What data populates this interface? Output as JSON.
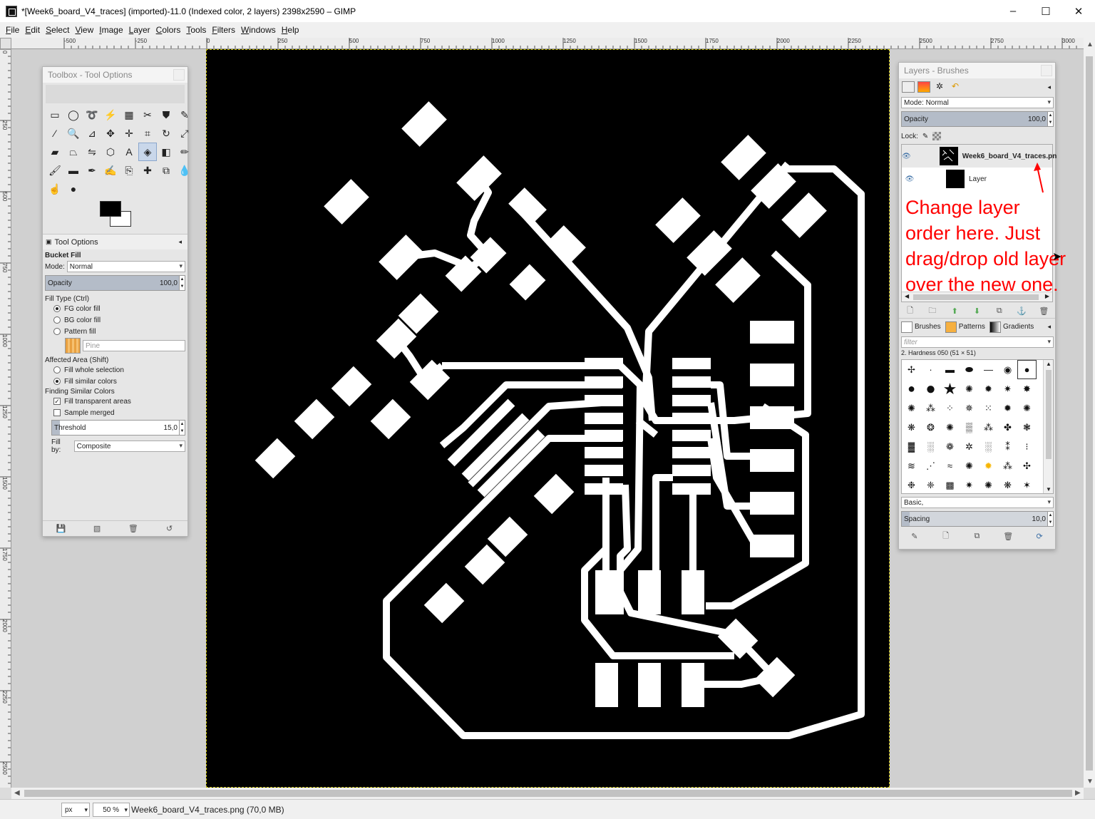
{
  "window": {
    "title": "*[Week6_board_V4_traces] (imported)-11.0 (Indexed color, 2 layers) 2398x2590 – GIMP",
    "minimize": "–",
    "maximize": "☐",
    "close": "✕"
  },
  "menu": [
    "File",
    "Edit",
    "Select",
    "View",
    "Image",
    "Layer",
    "Colors",
    "Tools",
    "Filters",
    "Windows",
    "Help"
  ],
  "ruler": {
    "top_labels": [
      "-500",
      "-250",
      "0",
      "250",
      "500",
      "750",
      "1000",
      "1250",
      "1500",
      "1750",
      "2000",
      "2250",
      "2500",
      "2750",
      "3000"
    ],
    "left_labels": [
      "0",
      "250",
      "500",
      "750",
      "1000",
      "1250",
      "1500",
      "1750",
      "2000",
      "2250",
      "2500"
    ]
  },
  "toolbox": {
    "title": "Toolbox - Tool Options",
    "tool_options_tab": "Tool Options",
    "tool_name": "Bucket Fill",
    "mode_label": "Mode:",
    "mode_value": "Normal",
    "opacity_label": "Opacity",
    "opacity_value": "100,0",
    "fill_type_label": "Fill Type  (Ctrl)",
    "fill_types": [
      "FG color fill",
      "BG color fill",
      "Pattern fill"
    ],
    "fill_type_selected": 0,
    "pattern_name": "Pine",
    "affected_label": "Affected Area  (Shift)",
    "affected_options": [
      "Fill whole selection",
      "Fill similar colors"
    ],
    "affected_selected": 1,
    "finding_label": "Finding Similar Colors",
    "fill_transparent": "Fill transparent areas",
    "sample_merged": "Sample merged",
    "threshold_label": "Threshold",
    "threshold_value": "15,0",
    "fillby_label": "Fill by:",
    "fillby_value": "Composite"
  },
  "layers": {
    "title": "Layers - Brushes",
    "mode": "Mode: Normal",
    "opacity_label": "Opacity",
    "opacity_value": "100,0",
    "lock_label": "Lock:",
    "items": [
      {
        "name": "Week6_board_V4_traces.pn",
        "active": true
      },
      {
        "name": "Layer",
        "active": false
      }
    ]
  },
  "annotation": {
    "lines": [
      "Change layer",
      "order here. Just",
      "drag/drop old layer",
      "over the new one."
    ],
    "color": "#ff0000"
  },
  "brushes": {
    "tabs": [
      "Brushes",
      "Patterns",
      "Gradients"
    ],
    "filter_placeholder": "filter",
    "current": "2. Hardness 050 (51 × 51)",
    "preset": "Basic,",
    "spacing_label": "Spacing",
    "spacing_value": "10,0"
  },
  "status": {
    "unit": "px",
    "zoom": "50 %",
    "file_info": "Week6_board_V4_traces.png (70,0 MB)"
  },
  "colors": {
    "annotation": "#ff0000",
    "canvas_bg": "#000000",
    "traces": "#ffffff"
  }
}
